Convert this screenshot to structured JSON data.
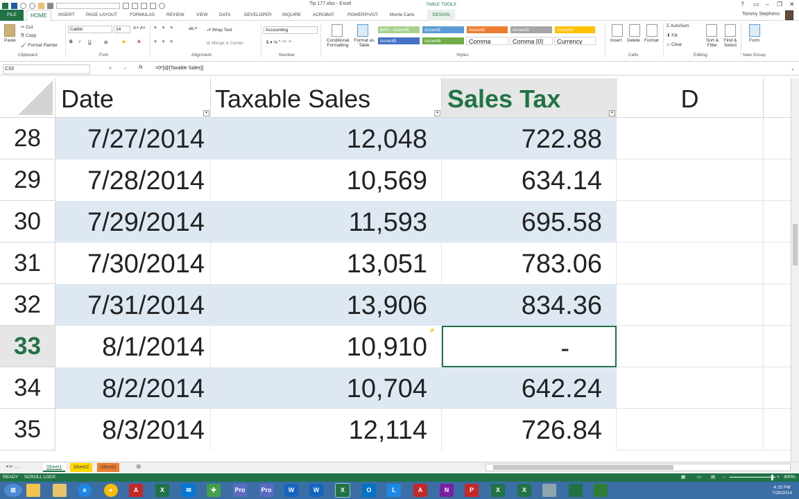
{
  "window": {
    "title": "Tip 177.xlsx - Excel",
    "table_tools": "TABLE TOOLS",
    "user": "Tommy Stephens"
  },
  "tabs": [
    "FILE",
    "HOME",
    "INSERT",
    "PAGE LAYOUT",
    "FORMULAS",
    "REVIEW",
    "VIEW",
    "DATA",
    "DEVELOPER",
    "INQUIRE",
    "ACROBAT",
    "POWERPIVOT",
    "Monte Carlo",
    "DESIGN"
  ],
  "ribbon": {
    "clipboard": {
      "paste": "Paste",
      "cut": "Cut",
      "copy": "Copy",
      "format_painter": "Format Painter",
      "label": "Clipboard"
    },
    "font": {
      "name": "Calibri",
      "size": "14",
      "label": "Font"
    },
    "alignment": {
      "wrap": "Wrap Text",
      "merge": "Merge & Center",
      "label": "Alignment"
    },
    "number": {
      "format": "Accounting",
      "label": "Number"
    },
    "styles": {
      "conditional": "Conditional Formatting",
      "format_table": "Format as Table",
      "cells": [
        {
          "text": "60% - Accent6",
          "bg": "#a9d08e",
          "fg": "#ffffff"
        },
        {
          "text": "Accent1",
          "bg": "#5b9bd5",
          "fg": "#ffffff"
        },
        {
          "text": "Accent2",
          "bg": "#ed7d31",
          "fg": "#ffffff"
        },
        {
          "text": "Accent3",
          "bg": "#a5a5a5",
          "fg": "#ffffff"
        },
        {
          "text": "Accent4",
          "bg": "#ffc000",
          "fg": "#ffffff"
        },
        {
          "text": "Accent5",
          "bg": "#4472c4",
          "fg": "#ffffff"
        },
        {
          "text": "Accent6",
          "bg": "#70ad47",
          "fg": "#ffffff"
        },
        {
          "text": "Comma",
          "bg": "#ffffff",
          "fg": "#222222"
        },
        {
          "text": "Comma [0]",
          "bg": "#ffffff",
          "fg": "#222222"
        },
        {
          "text": "Currency",
          "bg": "#ffffff",
          "fg": "#222222"
        }
      ],
      "label": "Styles"
    },
    "cells": {
      "insert": "Insert",
      "delete": "Delete",
      "format": "Format",
      "label": "Cells"
    },
    "editing": {
      "autosum": "AutoSum",
      "fill": "Fill",
      "clear": "Clear",
      "sort": "Sort & Filter",
      "find": "Find & Select",
      "label": "Editing"
    },
    "newgroup": {
      "form": "Form",
      "label": "New Group"
    }
  },
  "formula_bar": {
    "name_box": "C33",
    "fx": "fx",
    "formula": "=0*[@[Taxable Sales]]"
  },
  "grid": {
    "headers": {
      "a": "Date",
      "b": "Taxable Sales",
      "c": "Sales Tax",
      "d": "D"
    },
    "rows": [
      {
        "num": "28",
        "date": "7/27/2014",
        "sales": "12,048",
        "tax": "722.88"
      },
      {
        "num": "29",
        "date": "7/28/2014",
        "sales": "10,569",
        "tax": "634.14"
      },
      {
        "num": "30",
        "date": "7/29/2014",
        "sales": "11,593",
        "tax": "695.58"
      },
      {
        "num": "31",
        "date": "7/30/2014",
        "sales": "13,051",
        "tax": "783.06"
      },
      {
        "num": "32",
        "date": "7/31/2014",
        "sales": "13,906",
        "tax": "834.36"
      },
      {
        "num": "33",
        "date": "8/1/2014",
        "sales": "10,910",
        "tax": "-"
      },
      {
        "num": "34",
        "date": "8/2/2014",
        "sales": "10,704",
        "tax": "642.24"
      },
      {
        "num": "35",
        "date": "8/3/2014",
        "sales": "12,114",
        "tax": "726.84"
      }
    ]
  },
  "sheets": [
    "Sheet1",
    "Sheet2",
    "Sheet3"
  ],
  "status": {
    "ready": "READY",
    "scroll_lock": "SCROLL LOCK",
    "zoom": "400%"
  },
  "taskbar": {
    "icons": [
      "Pro",
      "Pro",
      "W",
      "W",
      "X",
      "O",
      "L",
      "A",
      "N",
      "P",
      "X",
      "X"
    ],
    "time": "4:25 PM",
    "date": "7/28/2014"
  },
  "colors": {
    "excel_green": "#217346",
    "band": "#dde8f3"
  }
}
